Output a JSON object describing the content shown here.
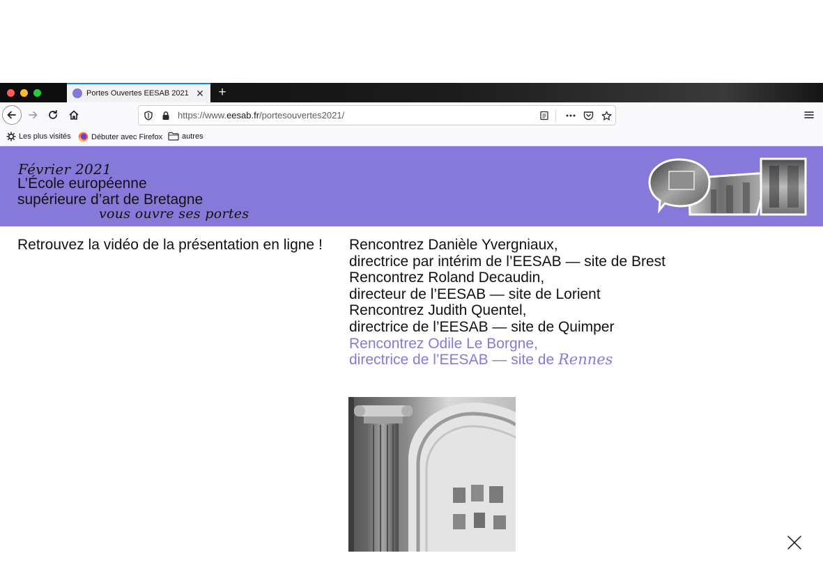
{
  "browser": {
    "tab_title": "Portes Ouvertes EESAB 2021",
    "tab_close": "✕",
    "new_tab": "+",
    "url": {
      "prefix": "https://www.",
      "domain": "eesab.fr",
      "path": "/portesouvertes2021/"
    },
    "bookmarks": [
      {
        "label": "Les plus visités",
        "icon": "gear-icon"
      },
      {
        "label": "Débuter avec Firefox",
        "icon": "firefox-icon"
      },
      {
        "label": "autres",
        "icon": "folder-icon"
      }
    ],
    "colors": {
      "accent": "#0a84ff",
      "favicon": "#8379d7"
    }
  },
  "header": {
    "date": "Février 2021",
    "line1": "L’École européenne",
    "line2": "supérieure d’art de Bretagne",
    "line3": "vous ouvre ses portes",
    "color": "#8679d9"
  },
  "main": {
    "left_text": "Retrouvez la vidéo de la présentation en ligne !",
    "contacts": [
      {
        "name": "Rencontrez Danièle Yvergniaux,",
        "role": "directrice par intérim de l’EESAB — site de Brest",
        "active": false
      },
      {
        "name": "Rencontrez Roland Decaudin,",
        "role": "directeur de l’EESAB — site de Lorient",
        "active": false
      },
      {
        "name": "Rencontrez Judith Quentel,",
        "role": "directrice de l’EESAB — site de Quimper",
        "active": false
      },
      {
        "name": "Rencontrez Odile Le Borgne,",
        "role": "directrice de l’EESAB — site de",
        "city": "Rennes",
        "active": true
      }
    ],
    "close_icon": "close-icon"
  }
}
